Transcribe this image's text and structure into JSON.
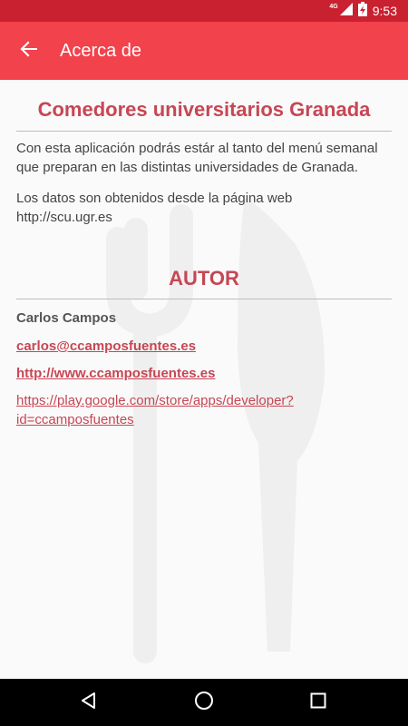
{
  "status_bar": {
    "network": "4G",
    "time": "9:53",
    "icons": [
      "signal-icon",
      "battery-charging-icon"
    ]
  },
  "app_bar": {
    "back_icon": "arrow-back-icon",
    "title": "Acerca de"
  },
  "about": {
    "title": "Comedores universitarios Granada",
    "description": "Con esta aplicación podrás estár al tanto del menú semanal que preparan en las distintas universidades de Granada.",
    "source": "Los datos son obtenidos desde la página web http://scu.ugr.es"
  },
  "author": {
    "section_title": "AUTOR",
    "name": "Carlos Campos",
    "email": "carlos@ccamposfuentes.es",
    "website": "http://www.ccamposfuentes.es",
    "store": "https://play.google.com/store/apps/developer?id=ccamposfuentes"
  },
  "colors": {
    "accent": "#c74654",
    "app_bar": "#f2424c",
    "status_bar": "#c9212f"
  },
  "nav_bar": {
    "icons": [
      "back-triangle-icon",
      "home-circle-icon",
      "recents-square-icon"
    ]
  }
}
